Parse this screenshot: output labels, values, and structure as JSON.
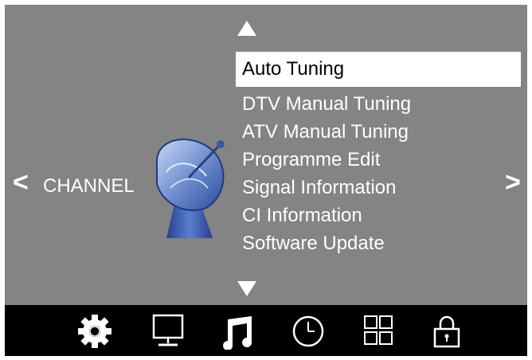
{
  "header": {
    "category": "CHANNEL"
  },
  "navigation": {
    "prev_symbol": "<",
    "next_symbol": ">",
    "scroll_up": "up-triangle",
    "scroll_down": "down-triangle"
  },
  "menu": {
    "items": [
      {
        "label": "Auto Tuning",
        "selected": true
      },
      {
        "label": "DTV Manual Tuning",
        "selected": false
      },
      {
        "label": "ATV Manual Tuning",
        "selected": false
      },
      {
        "label": "Programme Edit",
        "selected": false
      },
      {
        "label": "Signal Information",
        "selected": false
      },
      {
        "label": "CI Information",
        "selected": false
      },
      {
        "label": "Software Update",
        "selected": false
      }
    ]
  },
  "bottom_bar": {
    "icons": [
      "gear-icon",
      "monitor-icon",
      "music-note-icon",
      "clock-icon",
      "grid-icon",
      "lock-icon"
    ]
  },
  "colors": {
    "background": "#848484",
    "bar": "#000000",
    "highlight": "#ffffff",
    "text": "#ffffff",
    "dish": "#4a6fc0"
  }
}
